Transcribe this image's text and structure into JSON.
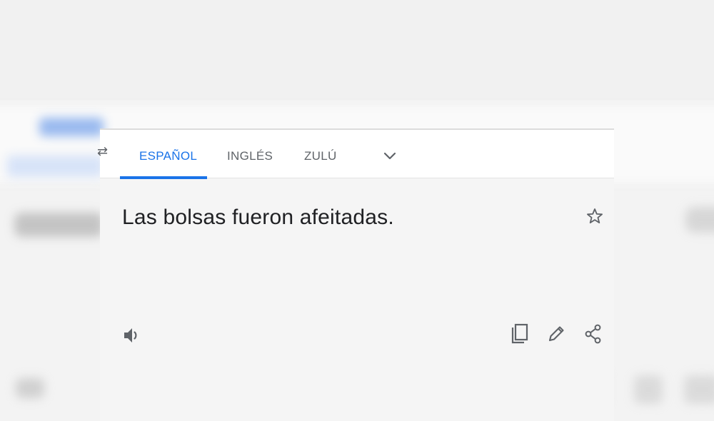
{
  "tabs": [
    {
      "label": "ESPAÑOL",
      "active": true
    },
    {
      "label": "INGLÉS",
      "active": false
    },
    {
      "label": "ZULÚ",
      "active": false
    }
  ],
  "swap_fragment": "⇄",
  "translation": {
    "text": "Las bolsas fueron afeitadas."
  },
  "icons": {
    "more_languages": "chevron-down-icon",
    "favorite": "star-icon",
    "listen": "speaker-icon",
    "copy": "copy-icon",
    "edit": "pencil-icon",
    "share": "share-icon"
  },
  "colors": {
    "accent": "#1a73e8",
    "text": "#202124",
    "muted": "#5f6368",
    "panel_bg": "#f5f5f5",
    "bar_bg": "#ffffff"
  }
}
